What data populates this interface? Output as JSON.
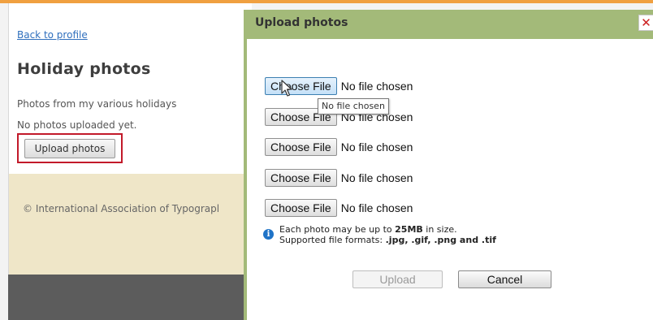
{
  "profile": {
    "back_link": "Back to profile",
    "title": "Holiday photos",
    "description": "Photos from my various holidays",
    "empty_message": "No photos uploaded yet.",
    "upload_button": "Upload photos",
    "copyright": "© International Association of Typograpl"
  },
  "dialog": {
    "title": "Upload photos",
    "close": "✕",
    "file_inputs": [
      {
        "button": "Choose File",
        "status": "No file chosen"
      },
      {
        "button": "Choose File",
        "status": "No file chosen"
      },
      {
        "button": "Choose File",
        "status": "No file chosen"
      },
      {
        "button": "Choose File",
        "status": "No file chosen"
      },
      {
        "button": "Choose File",
        "status": "No file chosen"
      }
    ],
    "tooltip": "No file chosen",
    "info": {
      "line1_pre": "Each photo may be up to ",
      "line1_bold": "25MB",
      "line1_post": " in size.",
      "line2_pre": "Supported file formats: ",
      "line2_bold": ".jpg, .gif, .png and .tif"
    },
    "upload_button": "Upload",
    "cancel_button": "Cancel"
  },
  "colors": {
    "accent_border": "#c21a2a",
    "dialog_frame": "#a3ba79",
    "link": "#2f6fbd"
  },
  "icons": {
    "close": "close-icon",
    "info": "info-icon",
    "cursor": "mouse-cursor-icon"
  }
}
